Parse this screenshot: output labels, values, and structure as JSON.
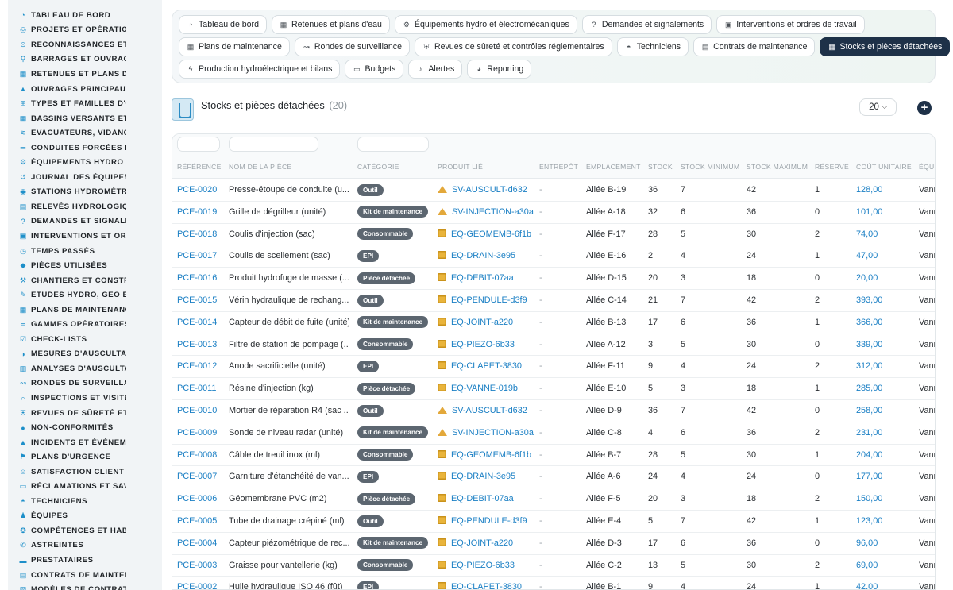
{
  "sidebar": {
    "items": [
      {
        "label": "TABLEAU DE BORD",
        "icon": "dashboard-icon"
      },
      {
        "label": "PROJETS ET OPÉRATION",
        "icon": "target-icon"
      },
      {
        "label": "RECONNAISSANCES ET V",
        "icon": "binoculars-icon"
      },
      {
        "label": "BARRAGES ET OUVRAGE",
        "icon": "map-pin-icon"
      },
      {
        "label": "RETENUES ET PLANS D'E",
        "icon": "building-icon"
      },
      {
        "label": "OUVRAGES PRINCIPAUX",
        "icon": "dam-icon"
      },
      {
        "label": "TYPES ET FAMILLES D'OU",
        "icon": "sitemap-icon"
      },
      {
        "label": "BASSINS VERSANTS ET A",
        "icon": "grid-icon"
      },
      {
        "label": "ÉVACUATEURS, VIDANGE",
        "icon": "outflow-icon"
      },
      {
        "label": "CONDUITES FORCÉES ET",
        "icon": "pipe-icon"
      },
      {
        "label": "ÉQUIPEMENTS HYDRO ET",
        "icon": "gears-icon"
      },
      {
        "label": "JOURNAL DES ÉQUIPEME",
        "icon": "history-icon"
      },
      {
        "label": "STATIONS HYDROMÉTRIC",
        "icon": "station-icon"
      },
      {
        "label": "RELEVÉS HYDROLOGIQU",
        "icon": "table-icon"
      },
      {
        "label": "DEMANDES ET SIGNALEM",
        "icon": "question-icon"
      },
      {
        "label": "INTERVENTIONS ET ORDI",
        "icon": "clipboard-icon"
      },
      {
        "label": "TEMPS PASSÉS",
        "icon": "clock-icon"
      },
      {
        "label": "PIÈCES UTILISÉES",
        "icon": "parts-icon"
      },
      {
        "label": "CHANTIERS ET CONSTRU",
        "icon": "hammer-icon"
      },
      {
        "label": "ÉTUDES HYDRO, GÉO ET",
        "icon": "study-icon"
      },
      {
        "label": "PLANS DE MAINTENANCE",
        "icon": "calendar-icon"
      },
      {
        "label": "GAMMES OPÉRATOIRES",
        "icon": "list-icon"
      },
      {
        "label": "CHECK-LISTS",
        "icon": "checklist-icon"
      },
      {
        "label": "MESURES D'AUSCULTATI",
        "icon": "gauge-icon"
      },
      {
        "label": "ANALYSES D'AUSCULTAT",
        "icon": "chart-icon"
      },
      {
        "label": "RONDES DE SURVEILLAN",
        "icon": "route-icon"
      },
      {
        "label": "INSPECTIONS ET VISITES",
        "icon": "search-icon"
      },
      {
        "label": "REVUES DE SÛRETÉ ET C",
        "icon": "shield-icon"
      },
      {
        "label": "NON-CONFORMITÉS",
        "icon": "alert-icon"
      },
      {
        "label": "INCIDENTS ET ÉVÉNEMEN",
        "icon": "warning-icon"
      },
      {
        "label": "PLANS D'URGENCE",
        "icon": "flag-icon"
      },
      {
        "label": "SATISFACTION CLIENT",
        "icon": "smile-icon"
      },
      {
        "label": "RÉCLAMATIONS ET SAV",
        "icon": "comment-icon"
      },
      {
        "label": "TECHNICIENS",
        "icon": "helmet-icon"
      },
      {
        "label": "ÉQUIPES",
        "icon": "users-icon"
      },
      {
        "label": "COMPÉTENCES ET HABIL",
        "icon": "badge-icon"
      },
      {
        "label": "ASTREINTES",
        "icon": "phone-icon"
      },
      {
        "label": "PRESTATAIRES",
        "icon": "briefcase-icon"
      },
      {
        "label": "CONTRATS DE MAINTENA",
        "icon": "contract-icon"
      },
      {
        "label": "MODÈLES DE CONTRATS",
        "icon": "template-icon"
      }
    ]
  },
  "nav": {
    "rows": [
      [
        {
          "label": "Tableau de bord",
          "icon": "dashboard-icon",
          "active": false
        },
        {
          "label": "Retenues et plans d'eau",
          "icon": "building-icon",
          "active": false
        },
        {
          "label": "Équipements hydro et électromécaniques",
          "icon": "gears-icon",
          "active": false
        },
        {
          "label": "Demandes et signalements",
          "icon": "question-icon",
          "active": false
        },
        {
          "label": "Interventions et ordres de travail",
          "icon": "clipboard-icon",
          "active": false
        }
      ],
      [
        {
          "label": "Plans de maintenance",
          "icon": "calendar-icon",
          "active": false
        },
        {
          "label": "Rondes de surveillance",
          "icon": "route-icon",
          "active": false
        },
        {
          "label": "Revues de sûreté et contrôles réglementaires",
          "icon": "shield-icon",
          "active": false
        },
        {
          "label": "Techniciens",
          "icon": "helmet-icon",
          "active": false
        },
        {
          "label": "Contrats de maintenance",
          "icon": "contract-icon",
          "active": false
        },
        {
          "label": "Stocks et pièces détachées",
          "icon": "boxes-icon",
          "active": true
        }
      ],
      [
        {
          "label": "Production hydroélectrique et bilans",
          "icon": "bolt-icon",
          "active": false
        },
        {
          "label": "Budgets",
          "icon": "money-icon",
          "active": false
        },
        {
          "label": "Alertes",
          "icon": "bell-icon",
          "active": false
        },
        {
          "label": "Reporting",
          "icon": "pie-icon",
          "active": false
        }
      ]
    ]
  },
  "header": {
    "title": "Stocks et pièces détachées",
    "count": "(20)",
    "per_page": "20"
  },
  "table": {
    "columns": [
      "RÉFÉRENCE",
      "NOM DE LA PIÈCE",
      "CATÉGORIE",
      "PRODUIT LIÉ",
      "ENTREPÔT",
      "EMPLACEMENT",
      "STOCK",
      "STOCK MINIMUM",
      "STOCK MAXIMUM",
      "RÉSERVÉ",
      "COÛT UNITAIRE",
      "ÉQU"
    ],
    "rows": [
      {
        "ref": "PCE-0020",
        "name": "Presse-étoupe de conduite (u...",
        "cat": "Outil",
        "prod": "SV-AUSCULT-d632",
        "prod_icon": "dam",
        "wh": "-",
        "loc": "Allée B-19",
        "stock": "36",
        "min": "7",
        "max": "42",
        "res": "1",
        "cost": "128,00",
        "equ": "Vann"
      },
      {
        "ref": "PCE-0019",
        "name": "Grille de dégrilleur (unité)",
        "cat": "Kit de maintenance",
        "prod": "SV-INJECTION-a30a",
        "prod_icon": "dam",
        "wh": "-",
        "loc": "Allée A-18",
        "stock": "32",
        "min": "6",
        "max": "36",
        "res": "0",
        "cost": "101,00",
        "equ": "Vann"
      },
      {
        "ref": "PCE-0018",
        "name": "Coulis d'injection (sac)",
        "cat": "Consommable",
        "prod": "EQ-GEOMEMB-6f1b",
        "prod_icon": "cube",
        "wh": "-",
        "loc": "Allée F-17",
        "stock": "28",
        "min": "5",
        "max": "30",
        "res": "2",
        "cost": "74,00",
        "equ": "Vann"
      },
      {
        "ref": "PCE-0017",
        "name": "Coulis de scellement (sac)",
        "cat": "EPI",
        "prod": "EQ-DRAIN-3e95",
        "prod_icon": "cube",
        "wh": "-",
        "loc": "Allée E-16",
        "stock": "2",
        "min": "4",
        "max": "24",
        "res": "1",
        "cost": "47,00",
        "equ": "Vann"
      },
      {
        "ref": "PCE-0016",
        "name": "Produit hydrofuge de masse (...",
        "cat": "Pièce détachée",
        "prod": "EQ-DEBIT-07aa",
        "prod_icon": "cube",
        "wh": "-",
        "loc": "Allée D-15",
        "stock": "20",
        "min": "3",
        "max": "18",
        "res": "0",
        "cost": "20,00",
        "equ": "Vann"
      },
      {
        "ref": "PCE-0015",
        "name": "Vérin hydraulique de rechang...",
        "cat": "Outil",
        "prod": "EQ-PENDULE-d3f9",
        "prod_icon": "cube",
        "wh": "-",
        "loc": "Allée C-14",
        "stock": "21",
        "min": "7",
        "max": "42",
        "res": "2",
        "cost": "393,00",
        "equ": "Vann"
      },
      {
        "ref": "PCE-0014",
        "name": "Capteur de débit de fuite (unité)",
        "cat": "Kit de maintenance",
        "prod": "EQ-JOINT-a220",
        "prod_icon": "cube",
        "wh": "-",
        "loc": "Allée B-13",
        "stock": "17",
        "min": "6",
        "max": "36",
        "res": "1",
        "cost": "366,00",
        "equ": "Vann"
      },
      {
        "ref": "PCE-0013",
        "name": "Filtre de station de pompage (...",
        "cat": "Consommable",
        "prod": "EQ-PIEZO-6b33",
        "prod_icon": "cube",
        "wh": "-",
        "loc": "Allée A-12",
        "stock": "3",
        "min": "5",
        "max": "30",
        "res": "0",
        "cost": "339,00",
        "equ": "Vann"
      },
      {
        "ref": "PCE-0012",
        "name": "Anode sacrificielle (unité)",
        "cat": "EPI",
        "prod": "EQ-CLAPET-3830",
        "prod_icon": "cube",
        "wh": "-",
        "loc": "Allée F-11",
        "stock": "9",
        "min": "4",
        "max": "24",
        "res": "2",
        "cost": "312,00",
        "equ": "Vann"
      },
      {
        "ref": "PCE-0011",
        "name": "Résine d'injection (kg)",
        "cat": "Pièce détachée",
        "prod": "EQ-VANNE-019b",
        "prod_icon": "cube",
        "wh": "-",
        "loc": "Allée E-10",
        "stock": "5",
        "min": "3",
        "max": "18",
        "res": "1",
        "cost": "285,00",
        "equ": "Vann"
      },
      {
        "ref": "PCE-0010",
        "name": "Mortier de réparation R4 (sac ...",
        "cat": "Outil",
        "prod": "SV-AUSCULT-d632",
        "prod_icon": "dam",
        "wh": "-",
        "loc": "Allée D-9",
        "stock": "36",
        "min": "7",
        "max": "42",
        "res": "0",
        "cost": "258,00",
        "equ": "Vann"
      },
      {
        "ref": "PCE-0009",
        "name": "Sonde de niveau radar (unité)",
        "cat": "Kit de maintenance",
        "prod": "SV-INJECTION-a30a",
        "prod_icon": "dam",
        "wh": "-",
        "loc": "Allée C-8",
        "stock": "4",
        "min": "6",
        "max": "36",
        "res": "2",
        "cost": "231,00",
        "equ": "Vann"
      },
      {
        "ref": "PCE-0008",
        "name": "Câble de treuil inox (ml)",
        "cat": "Consommable",
        "prod": "EQ-GEOMEMB-6f1b",
        "prod_icon": "cube",
        "wh": "-",
        "loc": "Allée B-7",
        "stock": "28",
        "min": "5",
        "max": "30",
        "res": "1",
        "cost": "204,00",
        "equ": "Vann"
      },
      {
        "ref": "PCE-0007",
        "name": "Garniture d'étanchéité de van...",
        "cat": "EPI",
        "prod": "EQ-DRAIN-3e95",
        "prod_icon": "cube",
        "wh": "-",
        "loc": "Allée A-6",
        "stock": "24",
        "min": "4",
        "max": "24",
        "res": "0",
        "cost": "177,00",
        "equ": "Vann"
      },
      {
        "ref": "PCE-0006",
        "name": "Géomembrane PVC (m2)",
        "cat": "Pièce détachée",
        "prod": "EQ-DEBIT-07aa",
        "prod_icon": "cube",
        "wh": "-",
        "loc": "Allée F-5",
        "stock": "20",
        "min": "3",
        "max": "18",
        "res": "2",
        "cost": "150,00",
        "equ": "Vann"
      },
      {
        "ref": "PCE-0005",
        "name": "Tube de drainage crépiné (ml)",
        "cat": "Outil",
        "prod": "EQ-PENDULE-d3f9",
        "prod_icon": "cube",
        "wh": "-",
        "loc": "Allée E-4",
        "stock": "5",
        "min": "7",
        "max": "42",
        "res": "1",
        "cost": "123,00",
        "equ": "Vann"
      },
      {
        "ref": "PCE-0004",
        "name": "Capteur piézométrique de rec...",
        "cat": "Kit de maintenance",
        "prod": "EQ-JOINT-a220",
        "prod_icon": "cube",
        "wh": "-",
        "loc": "Allée D-3",
        "stock": "17",
        "min": "6",
        "max": "36",
        "res": "0",
        "cost": "96,00",
        "equ": "Vann"
      },
      {
        "ref": "PCE-0003",
        "name": "Graisse pour vantellerie (kg)",
        "cat": "Consommable",
        "prod": "EQ-PIEZO-6b33",
        "prod_icon": "cube",
        "wh": "-",
        "loc": "Allée C-2",
        "stock": "13",
        "min": "5",
        "max": "30",
        "res": "2",
        "cost": "69,00",
        "equ": "Vann"
      },
      {
        "ref": "PCE-0002",
        "name": "Huile hydraulique ISO 46 (fût)",
        "cat": "EPI",
        "prod": "EQ-CLAPET-3830",
        "prod_icon": "cube",
        "wh": "-",
        "loc": "Allée B-1",
        "stock": "9",
        "min": "4",
        "max": "24",
        "res": "1",
        "cost": "42,00",
        "equ": "Vann"
      }
    ]
  },
  "colors": {
    "accent": "#1a7fc4",
    "active_pill": "#1e3148",
    "badge": "#5c6670",
    "sidebar_bg": "#f1f4f6"
  }
}
